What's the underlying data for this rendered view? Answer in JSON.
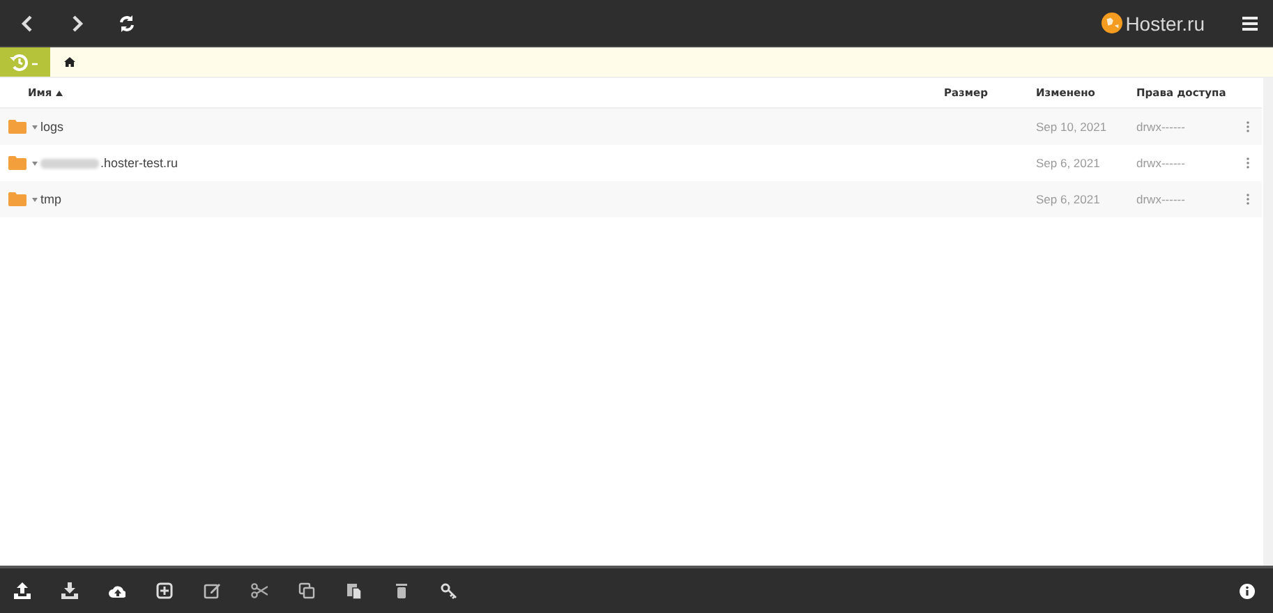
{
  "top_bar": {
    "logo_text": "Hoster.ru"
  },
  "breadcrumb": {
    "home": true
  },
  "table": {
    "columns": [
      {
        "label": "Имя",
        "sorted": true
      },
      {
        "label": "Размер",
        "sorted": false
      },
      {
        "label": "Изменено",
        "sorted": false
      },
      {
        "label": "Права доступа",
        "sorted": false
      }
    ],
    "rows": [
      {
        "name": "logs",
        "redacted": false,
        "modified": "Sep 10, 2021",
        "permissions": "drwx------"
      },
      {
        "name": ".hoster-test.ru",
        "redacted": true,
        "modified": "Sep 6, 2021",
        "permissions": "drwx------"
      },
      {
        "name": "tmp",
        "redacted": false,
        "modified": "Sep 6, 2021",
        "permissions": "drwx------"
      }
    ]
  },
  "toolbar": [
    {
      "kind": "upload"
    },
    {
      "kind": "download"
    },
    {
      "kind": "cloud"
    },
    {
      "kind": "new"
    },
    {
      "kind": "edit"
    },
    {
      "kind": "cut"
    },
    {
      "kind": "copy"
    },
    {
      "kind": "paste"
    },
    {
      "kind": "delete"
    },
    {
      "kind": "key"
    }
  ]
}
